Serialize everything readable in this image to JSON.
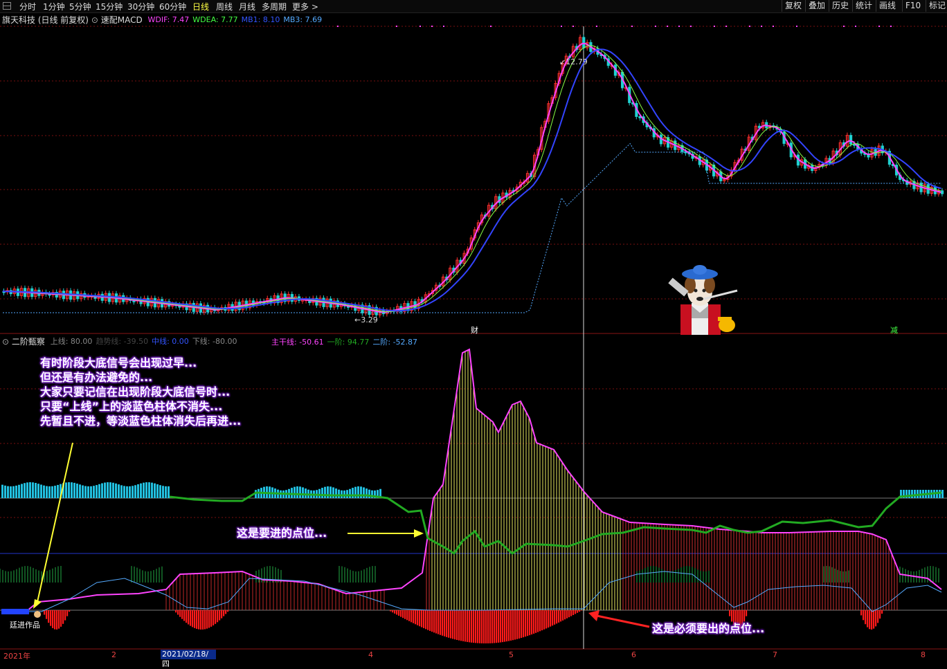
{
  "toolbar": {
    "timeframes": [
      "分时",
      "1分钟",
      "5分钟",
      "15分钟",
      "30分钟",
      "60分钟",
      "日线",
      "周线",
      "月线",
      "多周期",
      "更多 >"
    ],
    "active": "日线",
    "right_buttons": [
      "复权",
      "叠加",
      "历史",
      "统计",
      "画线",
      "F10",
      "标记"
    ]
  },
  "main_panel": {
    "title": "旗天科技 (日线 前复权)",
    "indicator_name": "速配MACD",
    "legend": [
      {
        "label": "WDIF: 7.47",
        "color": "#ff44ff"
      },
      {
        "label": "WDEA: 7.77",
        "color": "#44ff44"
      },
      {
        "label": "MB1: 8.10",
        "color": "#3355ff"
      },
      {
        "label": "MB3: 7.69",
        "color": "#55aaff"
      }
    ],
    "high_label": "12.79",
    "low_label": "3.29",
    "markers": [
      {
        "text": "财",
        "color": "#ffffff"
      },
      {
        "text": "减",
        "color": "#44ff44"
      }
    ]
  },
  "sub_panel": {
    "title": "二阶甄察",
    "legend_left": [
      {
        "label": "上线: 80.00",
        "color": "#888888"
      },
      {
        "label": "趋势线: -39.50",
        "color": "#444444"
      },
      {
        "label": "中线: 0.00",
        "color": "#3355ff"
      },
      {
        "label": "下线: -80.00",
        "color": "#888888"
      }
    ],
    "legend_right": [
      {
        "label": "主干线: -50.61",
        "color": "#ff44ff"
      },
      {
        "label": "一阶: 94.77",
        "color": "#22aa22"
      },
      {
        "label": "二阶: -52.87",
        "color": "#55aaff"
      }
    ]
  },
  "annotations": {
    "main_text": [
      "有时阶段大底信号会出现过早...",
      "但还是有办法避免的...",
      "大家只要记信在出现阶段大底信号时...",
      "只要“上线”上的淡蓝色柱体不消失...",
      "先暂且不进，等淡蓝色柱体消失后再进..."
    ],
    "enter_label": "这是要进的点位...",
    "exit_label": "这是必须要出的点位...",
    "credit": "廷进作品"
  },
  "x_axis": {
    "labels": [
      "2021年",
      "2",
      "4",
      "5",
      "6",
      "7",
      "8"
    ],
    "cursor_date": "2021/02/18/四"
  },
  "chart_data": {
    "type": "candlestick",
    "price_range": [
      3.29,
      12.79
    ],
    "peak_price": 12.79,
    "trough_price": 3.29,
    "cursor_date": "2021/02/18/四"
  }
}
